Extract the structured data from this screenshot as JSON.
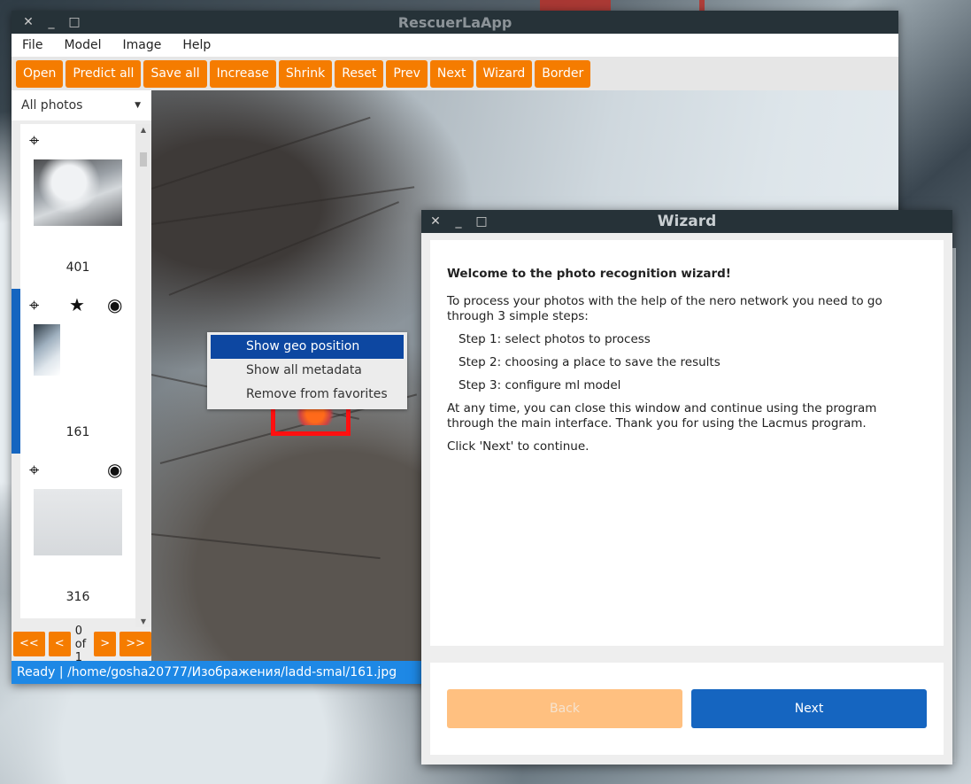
{
  "app": {
    "title": "RescuerLaApp",
    "menu": [
      "File",
      "Model",
      "Image",
      "Help"
    ],
    "toolbar": [
      "Open",
      "Predict all",
      "Save all",
      "Increase",
      "Shrink",
      "Reset",
      "Prev",
      "Next",
      "Wizard",
      "Border"
    ],
    "filter": {
      "selected": "All photos"
    },
    "photos": [
      {
        "number": "401",
        "geo": true,
        "favorite": false,
        "seen": false,
        "active": false
      },
      {
        "number": "161",
        "geo": true,
        "favorite": true,
        "seen": true,
        "active": true
      },
      {
        "number": "316",
        "geo": true,
        "favorite": false,
        "seen": true,
        "active": false
      }
    ],
    "pager": {
      "first": "<<",
      "prev": "<",
      "text": "0 of 1",
      "next": ">",
      "last": ">>"
    },
    "status": "Ready | /home/gosha20777/Изображения/ladd-smal/161.jpg"
  },
  "context_menu": {
    "items": [
      "Show geo position",
      "Show all metadata",
      "Remove from favorites"
    ],
    "highlighted": 0
  },
  "wizard": {
    "title": "Wizard",
    "heading": "Welcome to the photo recognition wizard!",
    "intro": "To process your photos with the help of the nero network you need to go through 3 simple steps:",
    "steps": [
      "Step 1: select photos to process",
      "Step 2: choosing a place to save the results",
      "Step 3: configure ml model"
    ],
    "note": "At any time, you can close this window and continue using the program through the main interface. Thank you for using the Lacmus program.",
    "continue": "Click 'Next' to continue.",
    "back_label": "Back",
    "next_label": "Next"
  },
  "colors": {
    "accent": "#f57c00",
    "primary": "#1565c0",
    "titlebar": "#263238",
    "status": "#1e88e5"
  },
  "icons": {
    "window_close": "✕",
    "window_min": "—",
    "window_max": "□",
    "geo": "⌖",
    "star": "★",
    "eye": "◉"
  }
}
